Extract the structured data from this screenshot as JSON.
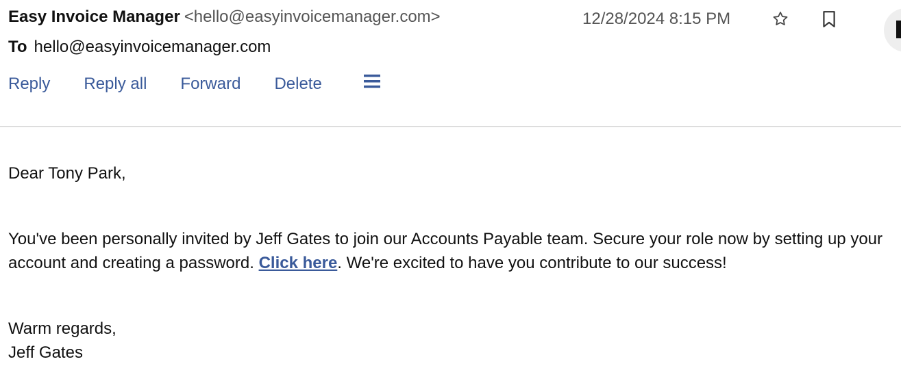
{
  "email": {
    "sender_name": "Easy Invoice Manager",
    "sender_email": "<hello@easyinvoicemanager.com>",
    "date": "12/28/2024 8:15 PM",
    "to_label": "To",
    "to_address": "hello@easyinvoicemanager.com"
  },
  "actions": {
    "reply": "Reply",
    "reply_all": "Reply all",
    "forward": "Forward",
    "delete": "Delete"
  },
  "icons": {
    "star": "star-icon",
    "bookmark": "bookmark-icon",
    "menu": "hamburger-menu-icon"
  },
  "body": {
    "greeting": "Dear Tony Park,",
    "para_before_link": "You've been personally invited by Jeff Gates to join our Accounts Payable team. Secure your role now by setting up your account and creating a password. ",
    "link_text": "Click here",
    "para_after_link": ". We're excited to have you contribute to our success!",
    "signoff": "Warm regards,",
    "signature": "Jeff Gates"
  },
  "colors": {
    "link": "#3a5a9a",
    "divider": "#dddddd"
  }
}
